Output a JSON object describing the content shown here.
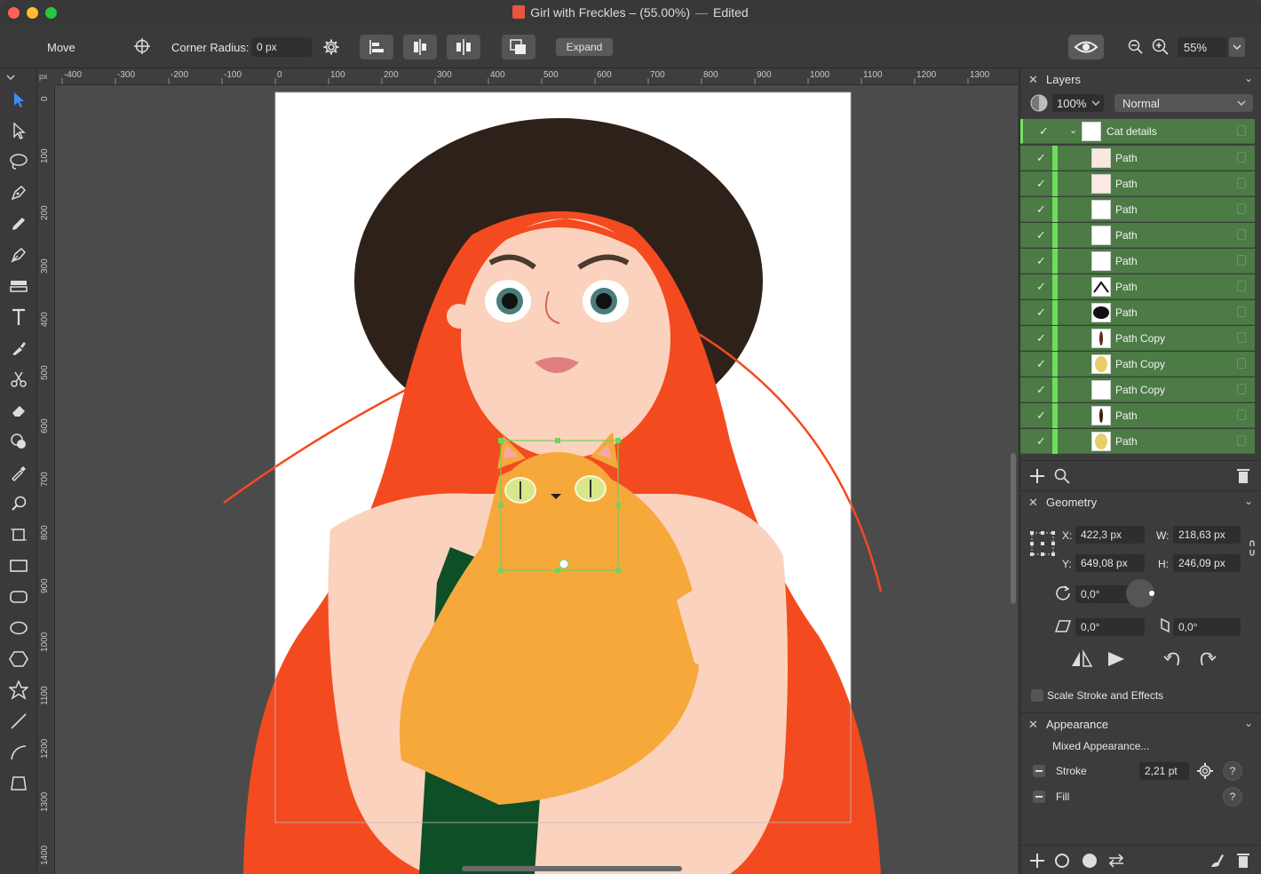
{
  "window": {
    "title": "Girl with Freckles – (55.00%)",
    "title_sep": "—",
    "status": "Edited",
    "traffic_colors": [
      "#ff5f57",
      "#febc2e",
      "#28c840"
    ]
  },
  "toolbar": {
    "tool_name": "Move",
    "corner_radius_label": "Corner Radius:",
    "corner_radius_value": "0 px",
    "expand_label": "Expand",
    "zoom_value": "55%"
  },
  "tools": [
    "select-arrow-icon",
    "direct-select-icon",
    "lasso-icon",
    "pen-icon",
    "pencil-icon",
    "vector-brush-icon",
    "fill-icon",
    "text-icon",
    "eyedropper-brush-icon",
    "scissors-icon",
    "eraser-icon",
    "shape-builder-icon",
    "color-picker-icon",
    "zoom-tool-icon",
    "artboard-icon",
    "rectangle-icon",
    "rounded-rect-icon",
    "ellipse-icon",
    "polygon-icon",
    "star-icon",
    "line-icon",
    "curve-icon",
    "transform-icon"
  ],
  "ruler": {
    "unit": "px",
    "top_labels": [
      "-400",
      "-300",
      "-200",
      "-100",
      "0",
      "100",
      "200",
      "300",
      "400",
      "500",
      "600",
      "700",
      "800",
      "900",
      "1000",
      "1100",
      "1200",
      "1300"
    ],
    "left_labels": [
      "0",
      "100",
      "200",
      "300",
      "400",
      "500",
      "600",
      "700",
      "800",
      "900",
      "1000",
      "1100",
      "1200",
      "1300",
      "1400"
    ]
  },
  "layers_panel": {
    "title": "Layers",
    "opacity": "100%",
    "blend_mode": "Normal",
    "group_name": "Cat details",
    "items": [
      {
        "name": "Path",
        "thumb": "#fbe7e0"
      },
      {
        "name": "Path",
        "thumb": "#fbe9e2"
      },
      {
        "name": "Path",
        "thumb": "#ffffff"
      },
      {
        "name": "Path",
        "thumb": "#ffffff"
      },
      {
        "name": "Path",
        "thumb": "#ffffff"
      },
      {
        "name": "Path",
        "thumb": "#ffffff"
      },
      {
        "name": "Path",
        "thumb": "#ffffff"
      },
      {
        "name": "Path Copy",
        "thumb": "#ffffff"
      },
      {
        "name": "Path Copy",
        "thumb": "#ffffff"
      },
      {
        "name": "Path Copy",
        "thumb": "#ffffff"
      },
      {
        "name": "Path",
        "thumb": "#ffffff"
      },
      {
        "name": "Path",
        "thumb": "#ffffff"
      }
    ]
  },
  "geometry_panel": {
    "title": "Geometry",
    "x_label": "X:",
    "x_value": "422,3 px",
    "y_label": "Y:",
    "y_value": "649,08 px",
    "w_label": "W:",
    "w_value": "218,63 px",
    "h_label": "H:",
    "h_value": "246,09 px",
    "rotation": "0,0°",
    "shear": "0,0°",
    "skew": "0,0°",
    "scale_stroke_label": "Scale Stroke and Effects"
  },
  "appearance_panel": {
    "title": "Appearance",
    "mixed_label": "Mixed Appearance...",
    "stroke_label": "Stroke",
    "stroke_value": "2,21 pt",
    "fill_label": "Fill",
    "help": "?"
  },
  "colors": {
    "layer_selected": "#4c7b46",
    "layer_bar": "#6fdc5d",
    "hair": "#f44a1f",
    "hat": "#2e2119",
    "skin": "#fbd2bd",
    "cat": "#f6a83b",
    "dress": "#0e4f27"
  }
}
